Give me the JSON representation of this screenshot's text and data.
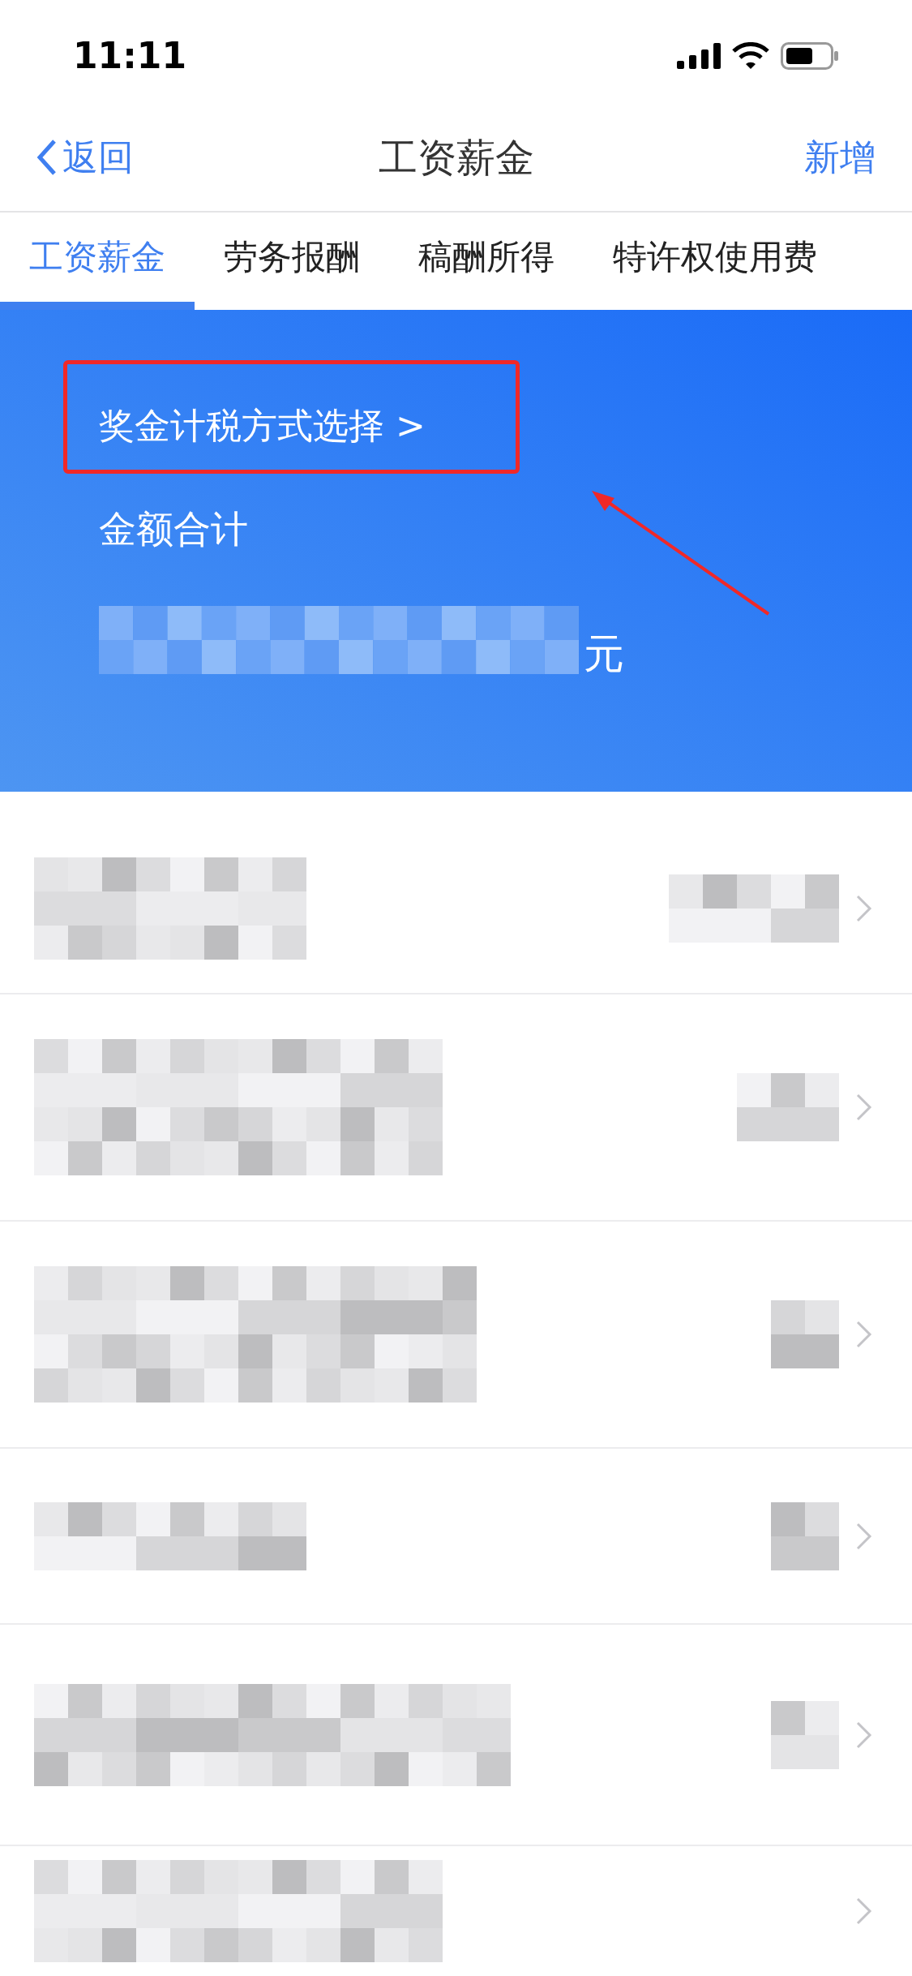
{
  "status_bar": {
    "time": "11:11"
  },
  "nav": {
    "back": "返回",
    "title": "工资薪金",
    "action": "新增"
  },
  "tabs": [
    {
      "label": "工资薪金",
      "selected": true
    },
    {
      "label": "劳务报酬",
      "selected": false
    },
    {
      "label": "稿酬所得",
      "selected": false
    },
    {
      "label": "特许权使用费",
      "selected": false
    }
  ],
  "summary": {
    "bonus_link": "奖金计税方式选择 >",
    "total_label": "金额合计",
    "unit": "元"
  }
}
